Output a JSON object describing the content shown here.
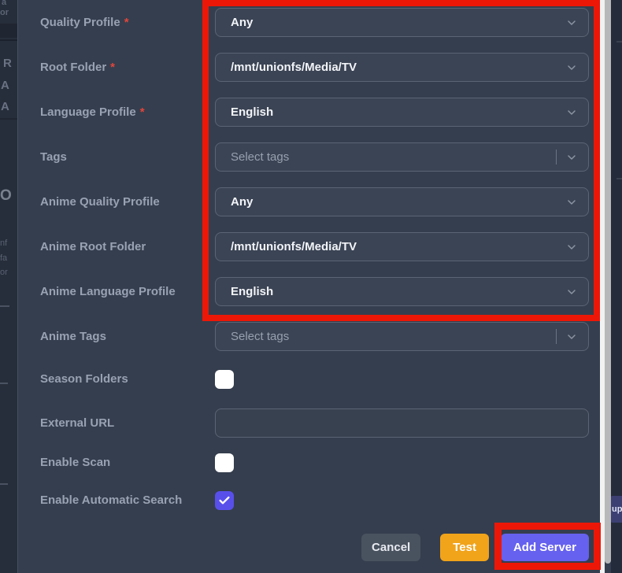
{
  "form": {
    "rows": [
      {
        "label": "Quality Profile",
        "required": "*",
        "value": "Any"
      },
      {
        "label": "Root Folder",
        "required": "*",
        "value": "/mnt/unionfs/Media/TV"
      },
      {
        "label": "Language Profile",
        "required": "*",
        "value": "English"
      },
      {
        "label": "Tags",
        "required": "",
        "placeholder": "Select tags"
      },
      {
        "label": "Anime Quality Profile",
        "required": "",
        "value": "Any"
      },
      {
        "label": "Anime Root Folder",
        "required": "",
        "value": "/mnt/unionfs/Media/TV"
      },
      {
        "label": "Anime Language Profile",
        "required": "",
        "value": "English"
      },
      {
        "label": "Anime Tags",
        "required": "",
        "placeholder": "Select tags"
      },
      {
        "label": "Season Folders",
        "required": "",
        "checked": false
      },
      {
        "label": "External URL",
        "required": "",
        "value": ""
      },
      {
        "label": "Enable Scan",
        "required": "",
        "checked": false
      },
      {
        "label": "Enable Automatic Search",
        "required": "",
        "checked": true
      }
    ]
  },
  "footer": {
    "cancel_label": "Cancel",
    "test_label": "Test",
    "add_server_label": "Add Server"
  },
  "colors": {
    "annotation_red": "#ed1707",
    "add_server_indigo": "#6661ee",
    "test_amber": "#f1a31a",
    "cancel_gray": "#49525f",
    "checkbox_checked_indigo": "#584feb",
    "panel_bg": "#353e4e",
    "select_bg": "#3b4454"
  },
  "background_page": {
    "f_a": "a",
    "f_or1": "or",
    "f_R": "R",
    "f_A1": "A",
    "f_A2": "A",
    "f_O": "O",
    "f_nf": "nf",
    "f_fa": "fa",
    "f_or2": "or",
    "f_up": "up"
  }
}
